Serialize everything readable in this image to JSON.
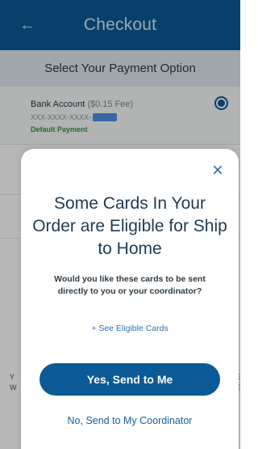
{
  "header": {
    "back_icon": "arrow-left-icon",
    "title": "Checkout"
  },
  "payment": {
    "section_title": "Select Your Payment Option",
    "bank_account_label": "Bank Account",
    "bank_account_fee": "($0.15 Fee)",
    "account_number_masked": "XXX-XXXX-XXXX-",
    "default_label": "Default Payment",
    "selected": true
  },
  "modal": {
    "close_icon": "close-icon",
    "heading": "Some Cards In Your Order are Eligible for Ship to Home",
    "question": "Would you like these cards to be sent directly to you or your coordinator?",
    "see_eligible_link": "+ See Eligible Cards",
    "primary_button": "Yes, Send to Me",
    "secondary_button": "No, Send to My Coordinator"
  },
  "colors": {
    "brand": "#0b5a95",
    "link": "#2f6fb4",
    "default_green": "#3f8f4a"
  }
}
